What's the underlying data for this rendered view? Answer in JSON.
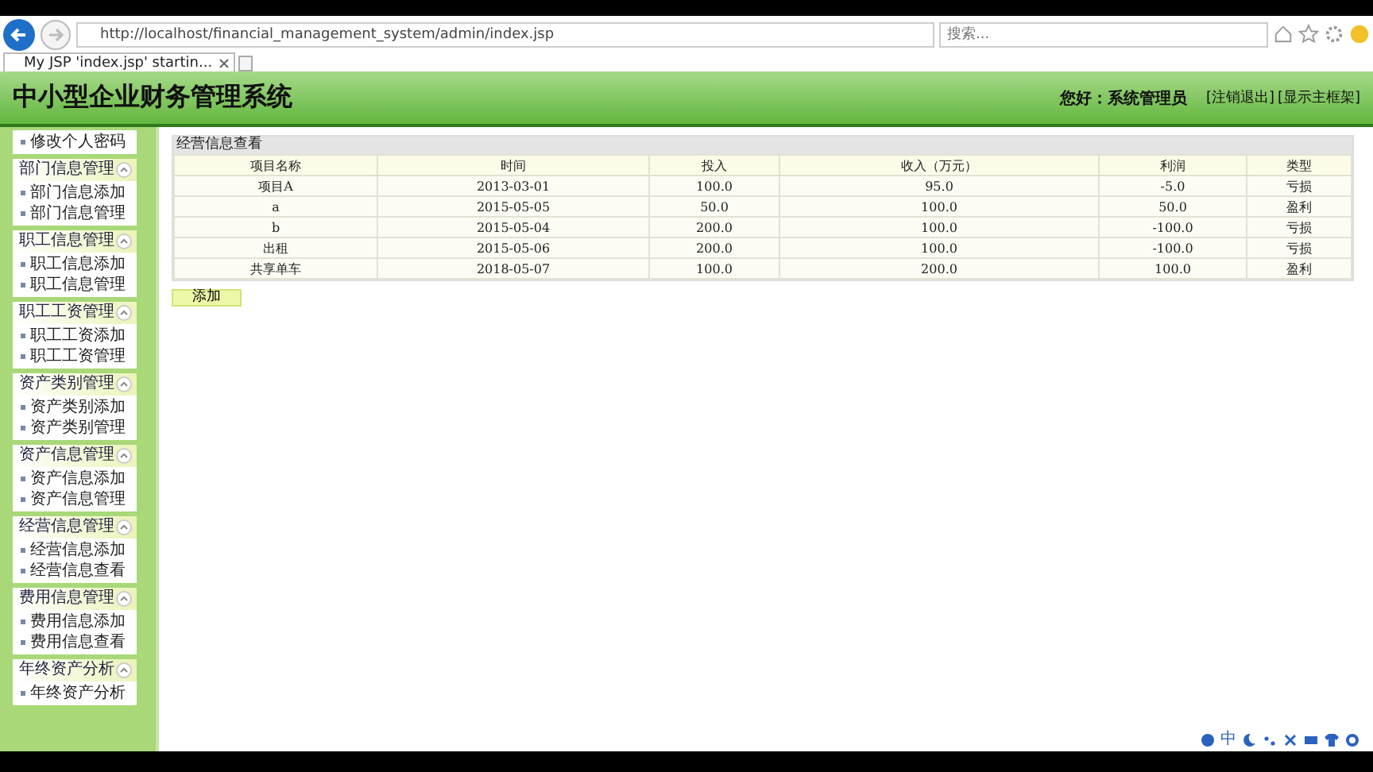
{
  "browser": {
    "url": "http://localhost/financial_management_system/admin/index.jsp",
    "search": {
      "placeholder": "搜索..."
    },
    "tabs": [
      {
        "label": "My JSP 'index.jsp' startin...",
        "selected": true
      }
    ]
  },
  "header": {
    "title": "中小型企业财务管理系统",
    "greeting": "您好：系统管理员",
    "links": [
      "[注销退出]",
      "[显示主框架]"
    ]
  },
  "sidebar": {
    "top_items": [
      "修改个人密码"
    ],
    "groups": [
      {
        "title": "部门信息管理",
        "items": [
          "部门信息添加",
          "部门信息管理"
        ]
      },
      {
        "title": "职工信息管理",
        "items": [
          "职工信息添加",
          "职工信息管理"
        ]
      },
      {
        "title": "职工工资管理",
        "items": [
          "职工工资添加",
          "职工工资管理"
        ]
      },
      {
        "title": "资产类别管理",
        "items": [
          "资产类别添加",
          "资产类别管理"
        ]
      },
      {
        "title": "资产信息管理",
        "items": [
          "资产信息添加",
          "资产信息管理"
        ]
      },
      {
        "title": "经营信息管理",
        "items": [
          "经营信息添加",
          "经营信息查看"
        ]
      },
      {
        "title": "费用信息管理",
        "items": [
          "费用信息添加",
          "费用信息查看"
        ]
      },
      {
        "title": "年终资产分析",
        "items": [
          "年终资产分析"
        ]
      }
    ]
  },
  "table": {
    "caption": "经营信息查看",
    "columns": [
      "项目名称",
      "时间",
      "投入",
      "收入（万元）",
      "利润",
      "类型"
    ],
    "rows": [
      [
        "项目A",
        "2013-03-01",
        "100.0",
        "95.0",
        "-5.0",
        "亏损"
      ],
      [
        "a",
        "2015-05-05",
        "50.0",
        "100.0",
        "50.0",
        "盈利"
      ],
      [
        "b",
        "2015-05-04",
        "200.0",
        "100.0",
        "-100.0",
        "亏损"
      ],
      [
        "出租",
        "2015-05-06",
        "200.0",
        "100.0",
        "-100.0",
        "亏损"
      ],
      [
        "共享单车",
        "2018-05-07",
        "100.0",
        "200.0",
        "100.0",
        "盈利"
      ]
    ]
  },
  "add_button": "添加",
  "ime_toolbar": {
    "mode": "中"
  }
}
